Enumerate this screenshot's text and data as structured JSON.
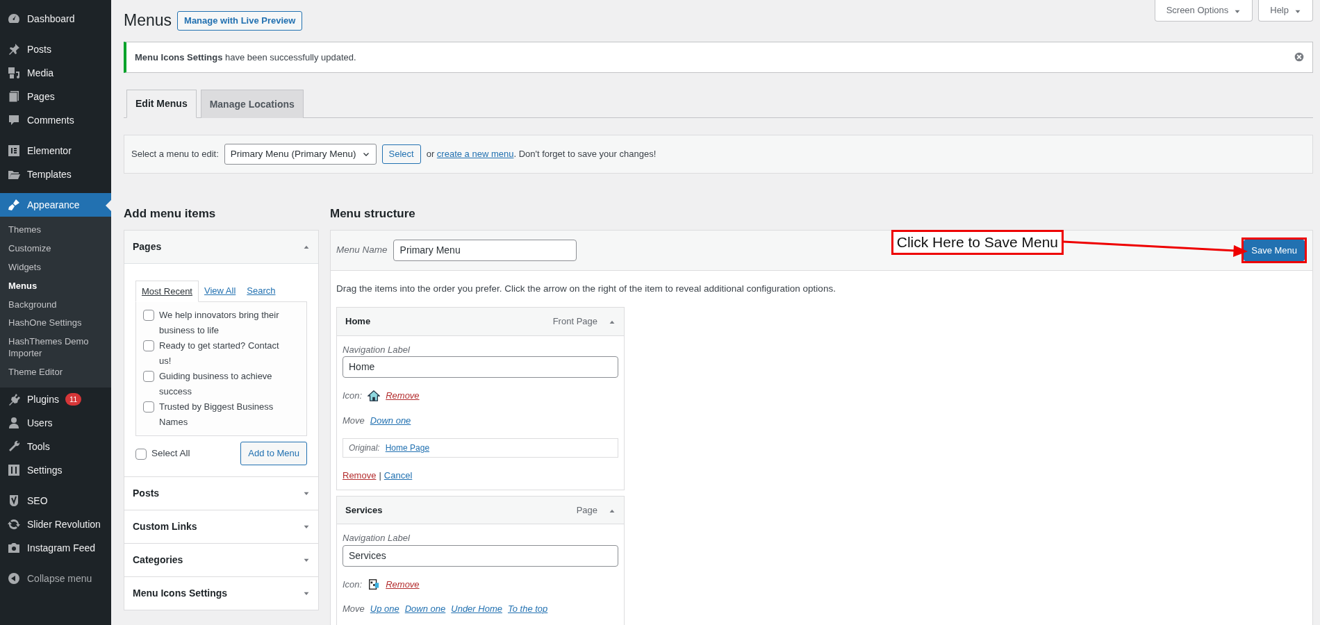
{
  "sidebar": {
    "groups": [
      [
        {
          "label": "Dashboard",
          "selected": false
        }
      ],
      [
        {
          "label": "Posts",
          "selected": false
        },
        {
          "label": "Media",
          "selected": false
        },
        {
          "label": "Pages",
          "selected": false
        },
        {
          "label": "Comments",
          "selected": false
        }
      ],
      [
        {
          "label": "Elementor",
          "selected": false
        },
        {
          "label": "Templates",
          "selected": false
        }
      ],
      [
        {
          "label": "Appearance",
          "selected": true,
          "children": [
            {
              "label": "Themes",
              "selected": false
            },
            {
              "label": "Customize",
              "selected": false
            },
            {
              "label": "Widgets",
              "selected": false
            },
            {
              "label": "Menus",
              "selected": true
            },
            {
              "label": "Background",
              "selected": false
            },
            {
              "label": "HashOne Settings",
              "selected": false
            },
            {
              "label": "HashThemes Demo Importer",
              "selected": false
            },
            {
              "label": "Theme Editor",
              "selected": false
            }
          ]
        },
        {
          "label": "Plugins",
          "selected": false,
          "badge": "11"
        },
        {
          "label": "Users",
          "selected": false
        },
        {
          "label": "Tools",
          "selected": false
        },
        {
          "label": "Settings",
          "selected": false
        }
      ],
      [
        {
          "label": "SEO",
          "selected": false
        },
        {
          "label": "Slider Revolution",
          "selected": false
        },
        {
          "label": "Instagram Feed",
          "selected": false
        }
      ]
    ],
    "collapse": "Collapse menu"
  },
  "header": {
    "title": "Menus",
    "live_preview": "Manage with Live Preview",
    "screen_options": "Screen Options",
    "help": "Help"
  },
  "notice": {
    "text": "**Menu Icons Settings** have been successfully updated."
  },
  "tabs": [
    {
      "label": "Edit Menus",
      "selected": true
    },
    {
      "label": "Manage Locations",
      "selected": false
    }
  ],
  "select_bar": {
    "label": "Select a menu to edit:",
    "value": "Primary Menu (Primary Menu)",
    "button": "Select",
    "before": "or ",
    "link": "create a new menu",
    "after": ". Don't forget to save your changes!"
  },
  "add_items": {
    "heading": "Add menu items",
    "sections": [
      {
        "title": "Pages",
        "expanded": true
      },
      {
        "title": "Posts",
        "expanded": false
      },
      {
        "title": "Custom Links",
        "expanded": false
      },
      {
        "title": "Categories",
        "expanded": false
      },
      {
        "title": "Menu Icons Settings",
        "expanded": false
      }
    ],
    "pages": {
      "tabs": [
        {
          "label": "Most Recent",
          "selected": true
        },
        {
          "label": "View All",
          "selected": false
        },
        {
          "label": "Search",
          "selected": false
        }
      ],
      "items": [
        {
          "label": "We help innovators bring their business to life",
          "checked": false
        },
        {
          "label": "Ready to get started? Contact us!",
          "checked": false
        },
        {
          "label": "Guiding business to achieve success",
          "checked": false
        },
        {
          "label": "Trusted by Biggest Business Names",
          "checked": false
        }
      ],
      "select_all": {
        "label": "Select All",
        "checked": false
      },
      "add_button": "Add to Menu"
    }
  },
  "structure": {
    "heading": "Menu structure",
    "name_label": "Menu Name",
    "name_value": "Primary Menu",
    "save": "Save Menu",
    "callout": "Click Here to Save Menu",
    "instructions": "Drag the items into the order you prefer. Click the arrow on the right of the item to reveal additional configuration options.",
    "items": [
      {
        "title": "Home",
        "type": "Front Page",
        "expanded": true,
        "nav_caption": "Navigation Label",
        "nav_value": "Home",
        "icon_caption": "Icon:",
        "icon_remove": "Remove",
        "move_caption": "Move",
        "move_links": [
          "Down one"
        ],
        "original_caption": "Original:",
        "original_link": "Home Page",
        "remove": "Remove",
        "separator": "|",
        "cancel": "Cancel"
      },
      {
        "title": "Services",
        "type": "Page",
        "expanded": true,
        "nav_caption": "Navigation Label",
        "nav_value": "Services",
        "icon_caption": "Icon:",
        "icon_remove": "Remove",
        "move_caption": "Move",
        "move_links": [
          "Up one",
          "Down one",
          "Under Home",
          "To the top"
        ]
      }
    ]
  }
}
